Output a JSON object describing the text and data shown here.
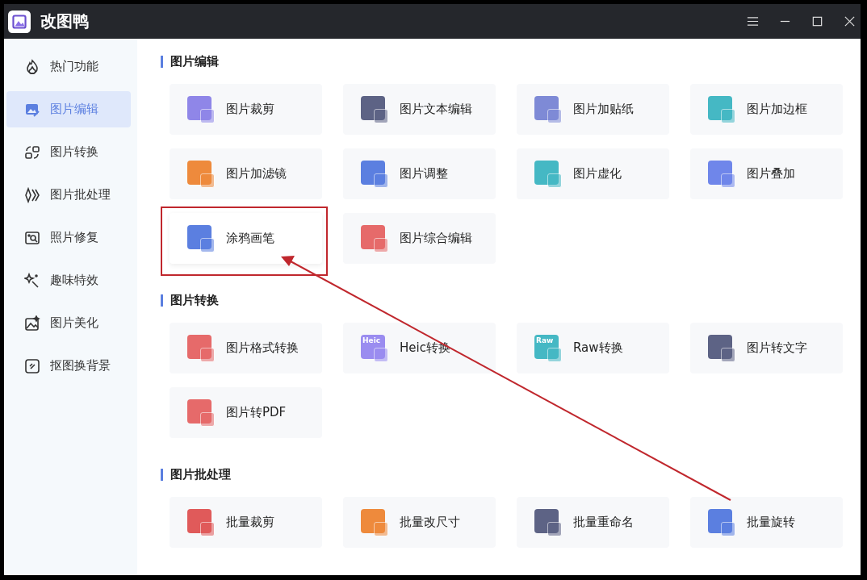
{
  "window": {
    "title": "改图鸭"
  },
  "sidebar": {
    "items": [
      {
        "label": "热门功能",
        "selected": false
      },
      {
        "label": "图片编辑",
        "selected": true
      },
      {
        "label": "图片转换",
        "selected": false
      },
      {
        "label": "图片批处理",
        "selected": false
      },
      {
        "label": "照片修复",
        "selected": false
      },
      {
        "label": "趣味特效",
        "selected": false
      },
      {
        "label": "图片美化",
        "selected": false
      },
      {
        "label": "抠图换背景",
        "selected": false
      }
    ]
  },
  "sections": [
    {
      "title": "图片编辑",
      "items": [
        {
          "label": "图片裁剪",
          "color": "#8f86e8",
          "highlighted": false
        },
        {
          "label": "图片文本编辑",
          "color": "#5d6385",
          "highlighted": false
        },
        {
          "label": "图片加贴纸",
          "color": "#7e8ad6",
          "highlighted": false
        },
        {
          "label": "图片加边框",
          "color": "#45b8c4",
          "highlighted": false
        },
        {
          "label": "图片加滤镜",
          "color": "#ee8a3c",
          "highlighted": false
        },
        {
          "label": "图片调整",
          "color": "#5b7fe0",
          "highlighted": false
        },
        {
          "label": "图片虚化",
          "color": "#45b8c4",
          "highlighted": false
        },
        {
          "label": "图片叠加",
          "color": "#6f86ea",
          "highlighted": false
        },
        {
          "label": "涂鸦画笔",
          "color": "#5b7fe0",
          "highlighted": true
        },
        {
          "label": "图片综合编辑",
          "color": "#e66a6a",
          "highlighted": false
        }
      ]
    },
    {
      "title": "图片转换",
      "items": [
        {
          "label": "图片格式转换",
          "color": "#e66a6a",
          "highlighted": false
        },
        {
          "label": "Heic转换",
          "color": "#9a8cf0",
          "icon_text": "Heic",
          "highlighted": false
        },
        {
          "label": "Raw转换",
          "color": "#45b8c4",
          "icon_text": "Raw",
          "highlighted": false
        },
        {
          "label": "图片转文字",
          "color": "#5d6385",
          "highlighted": false
        },
        {
          "label": "图片转PDF",
          "color": "#e66a6a",
          "highlighted": false
        }
      ]
    },
    {
      "title": "图片批处理",
      "items": [
        {
          "label": "批量裁剪",
          "color": "#e05a5a",
          "highlighted": false
        },
        {
          "label": "批量改尺寸",
          "color": "#ee8a3c",
          "highlighted": false
        },
        {
          "label": "批量重命名",
          "color": "#5d6385",
          "highlighted": false
        },
        {
          "label": "批量旋转",
          "color": "#5b7fe0",
          "highlighted": false
        }
      ]
    }
  ],
  "annotation_arrow": true
}
